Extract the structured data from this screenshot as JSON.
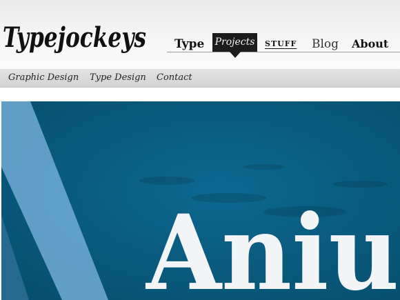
{
  "brand": {
    "logo_text": "Typejockeys"
  },
  "nav": {
    "items": [
      {
        "label": "Type"
      },
      {
        "label": "Projects",
        "active": true
      },
      {
        "label": "STUFF"
      },
      {
        "label": "Blog"
      },
      {
        "label": "About"
      }
    ]
  },
  "subnav": {
    "items": [
      {
        "label": "Graphic Design"
      },
      {
        "label": "Type Design"
      },
      {
        "label": "Contact"
      }
    ]
  },
  "hero": {
    "headline": "Aniul",
    "colors": {
      "background": "#0a5e83",
      "stripe": "#6aa6cf",
      "text": "#f2f4f5"
    }
  },
  "colors": {
    "active_tab": "#1c1c1c",
    "header_bg": "#f4f4f4",
    "subnav_bg": "#d9d9d9"
  }
}
